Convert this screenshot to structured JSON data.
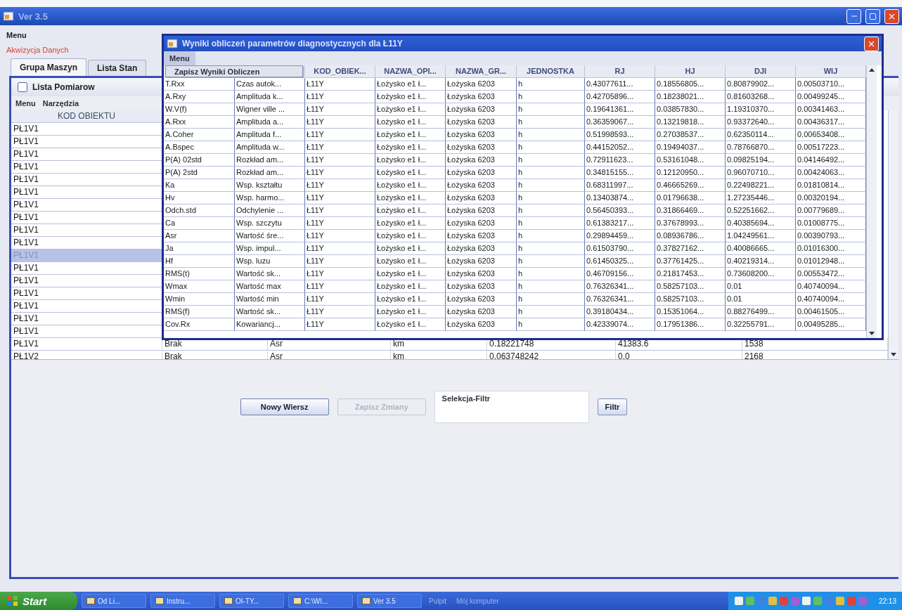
{
  "window": {
    "title": "Ver 3.5"
  },
  "menu": "Menu",
  "submenu": "Akwizycja Danych",
  "tabs": [
    {
      "label": "Grupa Maszyn",
      "selected": true
    },
    {
      "label": "Lista Stan",
      "selected": false
    }
  ],
  "frame": {
    "title": "Lista Pomiarow",
    "menus": [
      "Menu",
      "Narzędzia"
    ],
    "columns": [
      "KOD OBIEKTU"
    ],
    "rows": [
      {
        "cells": [
          "PŁ1V1"
        ],
        "selected": false
      },
      {
        "cells": [
          "PŁ1V1"
        ],
        "selected": false
      },
      {
        "cells": [
          "PŁ1V1"
        ],
        "selected": false
      },
      {
        "cells": [
          "PŁ1V1"
        ],
        "selected": false
      },
      {
        "cells": [
          "PŁ1V1"
        ],
        "selected": false
      },
      {
        "cells": [
          "PŁ1V1"
        ],
        "selected": false
      },
      {
        "cells": [
          "PŁ1V1"
        ],
        "selected": false
      },
      {
        "cells": [
          "PŁ1V1"
        ],
        "selected": false
      },
      {
        "cells": [
          "PŁ1V1"
        ],
        "selected": false
      },
      {
        "cells": [
          "PŁ1V1"
        ],
        "selected": false
      },
      {
        "cells": [
          "PŁ1V1"
        ],
        "selected": true
      },
      {
        "cells": [
          "PŁ1V1"
        ],
        "selected": false
      },
      {
        "cells": [
          "PŁ1V1"
        ],
        "selected": false
      },
      {
        "cells": [
          "PŁ1V1"
        ],
        "selected": false
      },
      {
        "cells": [
          "PŁ1V1"
        ],
        "selected": false
      },
      {
        "cells": [
          "PŁ1V1"
        ],
        "selected": false
      },
      {
        "cells": [
          "PŁ1V1"
        ],
        "selected": false
      },
      {
        "cells": [
          "PŁ1V1",
          "Brak",
          "Asr",
          "km",
          "0.18221748",
          "41383.6",
          "1538"
        ],
        "selected": false
      },
      {
        "cells": [
          "PŁ1V2",
          "Brak",
          "Asr",
          "km",
          "0.063748242",
          "0.0",
          "2168"
        ],
        "selected": false
      }
    ]
  },
  "buttons": [
    {
      "label": "Nowy Wiersz",
      "disabled": false
    },
    {
      "label": "Zapisz Zmiany",
      "disabled": true
    }
  ],
  "filter": {
    "label": "Selekcja-Filtr"
  },
  "filter_button": "Filtr",
  "dialog": {
    "title": "Wyniki obliczeń parametrów diagnostycznych dla Ł11Y",
    "menu": "Menu",
    "menu_items": [
      "Zapisz Wyniki Obliczen"
    ],
    "columns": [
      "",
      "",
      "KOD_OBIEK...",
      "NAZWA_OPI...",
      "NAZWA_GR...",
      "JEDNOSTKA",
      "RJ",
      "HJ",
      "DJI",
      "WIJ"
    ],
    "rows": [
      [
        "T.Rxx",
        "Czas autok...",
        "Ł11Y",
        "Łożysko e1 ł...",
        "Łożyska 6203",
        "h",
        "0.43077611...",
        "0.18556805...",
        "0.80879902...",
        "0.00503710..."
      ],
      [
        "A.Rxy",
        "Amplituda k...",
        "Ł11Y",
        "Łożysko e1 ł...",
        "Łożyska 6203",
        "h",
        "0.42705896...",
        "0.18238021...",
        "0.81603268...",
        "0.00499245..."
      ],
      [
        "W.V(f)",
        "Wigner ville ...",
        "Ł11Y",
        "Łożysko e1 ł...",
        "Łożyska 6203",
        "h",
        "0.19641361...",
        "0.03857830...",
        "1.19310370...",
        "0.00341463..."
      ],
      [
        "A.Rxx",
        "Amplituda a...",
        "Ł11Y",
        "Łożysko e1 ł...",
        "Łożyska 6203",
        "h",
        "0.36359067...",
        "0.13219818...",
        "0.93372640...",
        "0.00436317..."
      ],
      [
        "A.Coher",
        "Amplituda f...",
        "Ł11Y",
        "Łożysko e1 ł...",
        "Łożyska 6203",
        "h",
        "0.51998593...",
        "0.27038537...",
        "0.62350114...",
        "0.00653408..."
      ],
      [
        "A.Bspec",
        "Amplituda w...",
        "Ł11Y",
        "Łożysko e1 ł...",
        "Łożyska 6203",
        "h",
        "0.44152052...",
        "0.19494037...",
        "0.78766870...",
        "0.00517223..."
      ],
      [
        "P(A) 02std",
        "Rozkład am...",
        "Ł11Y",
        "Łożysko e1 ł...",
        "Łożyska 6203",
        "h",
        "0.72911623...",
        "0.53161048...",
        "0.09825194...",
        "0.04146492..."
      ],
      [
        "P(A) 2std",
        "Rozkład am...",
        "Ł11Y",
        "Łożysko e1 ł...",
        "Łożyska 6203",
        "h",
        "0.34815155...",
        "0.12120950...",
        "0.96070710...",
        "0.00424063..."
      ],
      [
        "Ka",
        "Wsp. kształtu",
        "Ł11Y",
        "Łożysko e1 ł...",
        "Łożyska 6203",
        "h",
        "0.68311997...",
        "0.46665269...",
        "0.22498221...",
        "0.01810814..."
      ],
      [
        "Hv",
        "Wsp. harmo...",
        "Ł11Y",
        "Łożysko e1 ł...",
        "Łożyska 6203",
        "h",
        "0.13403874...",
        "0.01796638...",
        "1.27235446...",
        "0.00320194..."
      ],
      [
        "Odch.std",
        "Odchylenie ...",
        "Ł11Y",
        "Łożysko e1 ł...",
        "Łożyska 6203",
        "h",
        "0.56450393...",
        "0.31866469...",
        "0.52251662...",
        "0.00779689..."
      ],
      [
        "Ca",
        "Wsp. szczytu",
        "Ł11Y",
        "Łożysko e1 ł...",
        "Łożyska 6203",
        "h",
        "0.61383217...",
        "0.37678993...",
        "0.40385694...",
        "0.01008775..."
      ],
      [
        "Asr",
        "Wartość śre...",
        "Ł11Y",
        "Łożysko e1 ł...",
        "Łożyska 6203",
        "h",
        "0.29894459...",
        "0.08936786...",
        "1.04249561...",
        "0.00390793..."
      ],
      [
        "Ja",
        "Wsp. impul...",
        "Ł11Y",
        "Łożysko e1 ł...",
        "Łożyska 6203",
        "h",
        "0.61503790...",
        "0.37827162...",
        "0.40086665...",
        "0.01016300..."
      ],
      [
        "Hf",
        "Wsp. luzu",
        "Ł11Y",
        "Łożysko e1 ł...",
        "Łożyska 6203",
        "h",
        "0.61450325...",
        "0.37761425...",
        "0.40219314...",
        "0.01012948..."
      ],
      [
        "RMS(t)",
        "Wartość sk...",
        "Ł11Y",
        "Łożysko e1 ł...",
        "Łożyska 6203",
        "h",
        "0.46709156...",
        "0.21817453...",
        "0.73608200...",
        "0.00553472..."
      ],
      [
        "Wmax",
        "Wartość max",
        "Ł11Y",
        "Łożysko e1 ł...",
        "Łożyska 6203",
        "h",
        "0.76326341...",
        "0.58257103...",
        "0.01",
        "0.40740094..."
      ],
      [
        "Wmin",
        "Wartość min",
        "Ł11Y",
        "Łożysko e1 ł...",
        "Łożyska 6203",
        "h",
        "0.76326341...",
        "0.58257103...",
        "0.01",
        "0.40740094..."
      ],
      [
        "RMS(f)",
        "Wartość sk...",
        "Ł11Y",
        "Łożysko e1 ł...",
        "Łożyska 6203",
        "h",
        "0.39180434...",
        "0.15351064...",
        "0.88276499...",
        "0.00461505..."
      ],
      [
        "Cov.Rx",
        "Kowariancj...",
        "Ł11Y",
        "Łożysko e1 ł...",
        "Łożyska 6203",
        "h",
        "0.42339074...",
        "0.17951386...",
        "0.32255791...",
        "0.00495285..."
      ]
    ]
  },
  "taskbar": {
    "start": "Start",
    "tasks": [
      "Od Li...",
      "Instru...",
      "OI-TY...",
      "C:\\WI...",
      "Ver 3.5"
    ],
    "quick": [
      "Pulpit",
      "Mój komputer"
    ],
    "clock": "22:13"
  }
}
